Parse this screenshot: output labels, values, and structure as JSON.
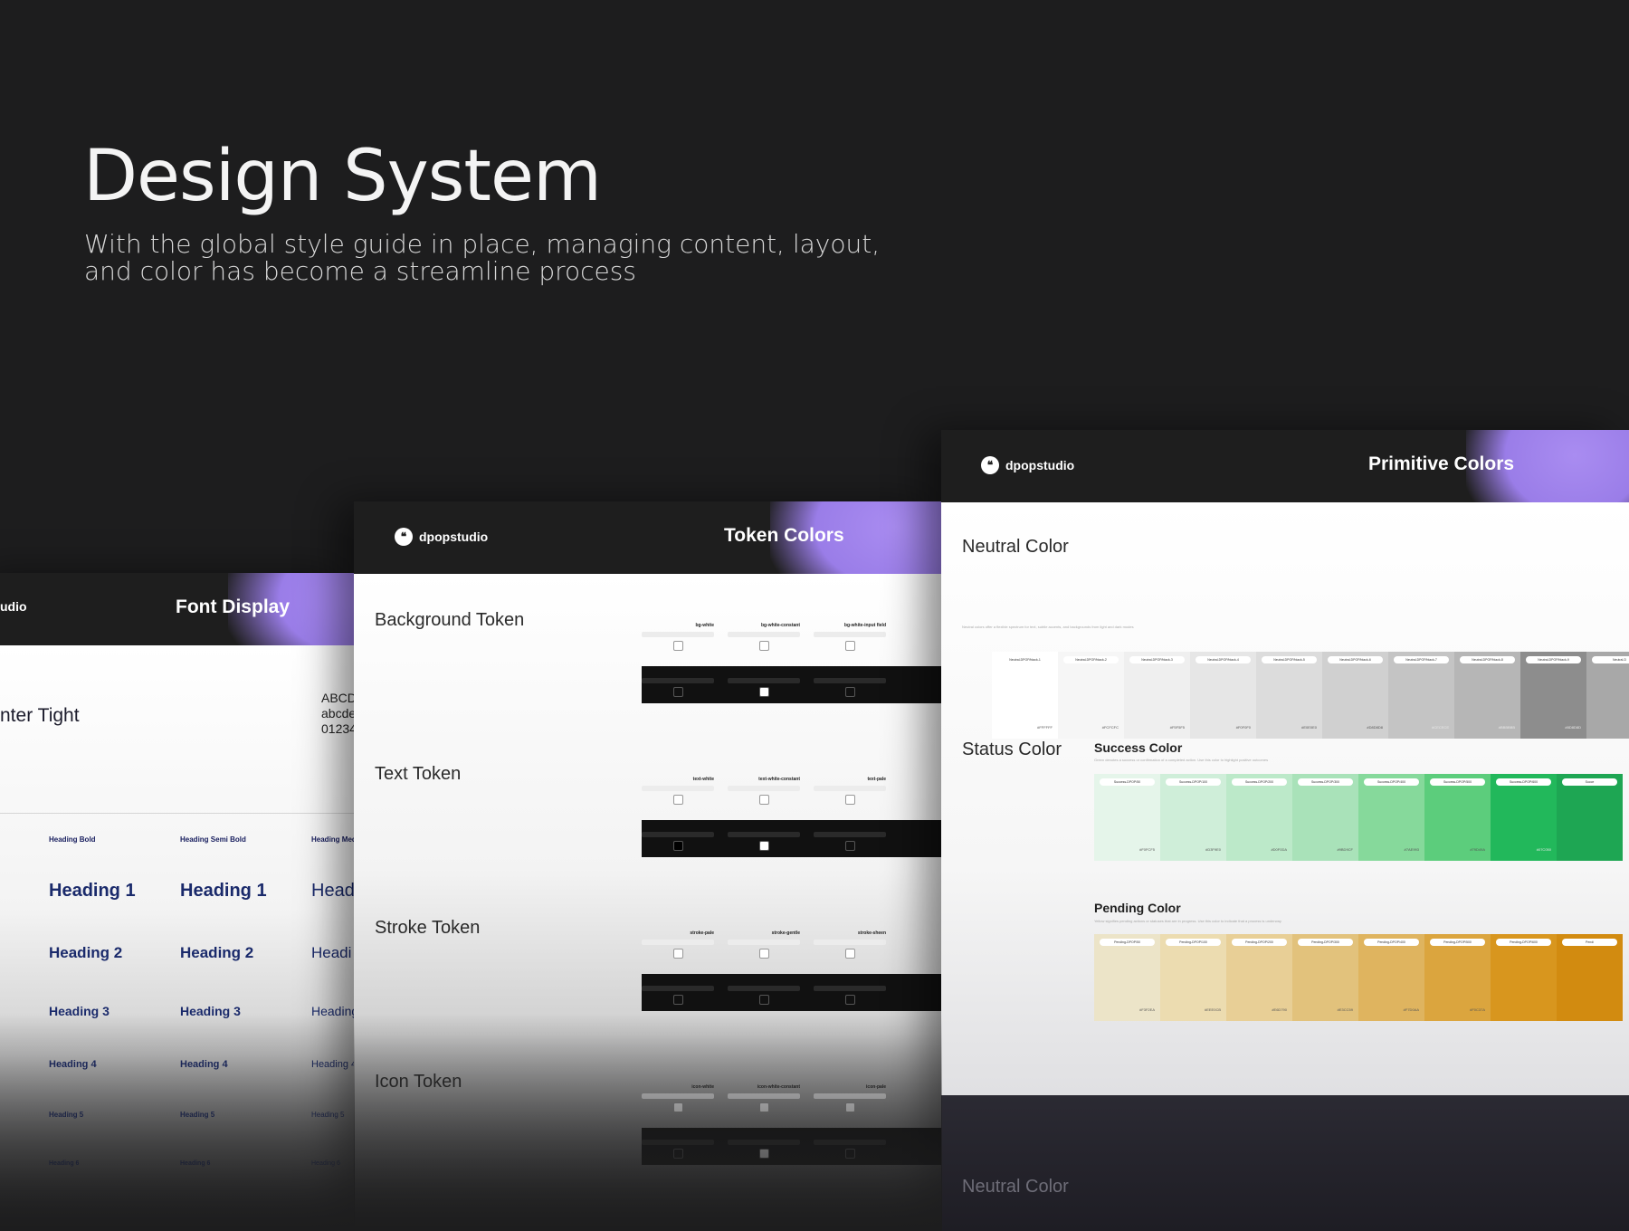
{
  "hero": {
    "title": "Design System",
    "subtitle": "With the global style guide in place, managing content, layout, and color has become a streamline process"
  },
  "brand": {
    "logo_text": "dpopstudio",
    "logo_partial": "udio",
    "accent": "#9a7de8"
  },
  "font_card": {
    "title": "Font Display",
    "font_name": "nter Tight",
    "glyphs": "ABCD\nabcde\n01234",
    "columns": [
      {
        "head": "Heading Bold",
        "items": [
          "Heading 1",
          "Heading 2",
          "Heading 3",
          "Heading 4",
          "Heading 5",
          "Heading 6"
        ]
      },
      {
        "head": "Heading Semi Bold",
        "items": [
          "Heading 1",
          "Heading 2",
          "Heading 3",
          "Heading 4",
          "Heading 5",
          "Heading 6"
        ]
      },
      {
        "head": "Heading Med",
        "items": [
          "Head",
          "Headi",
          "Heading",
          "Heading 4",
          "Heading 5",
          "Heading 6"
        ]
      }
    ]
  },
  "token_card": {
    "title": "Token Colors",
    "sections": [
      {
        "name": "Background Token",
        "tokens": [
          "bg-white",
          "bg-white-constant",
          "bg-white-input field"
        ]
      },
      {
        "name": "Text Token",
        "tokens": [
          "text-white",
          "text-white-constant",
          "text-pale"
        ]
      },
      {
        "name": "Stroke Token",
        "tokens": [
          "stroke-pale",
          "stroke-gentle",
          "stroke-sheen"
        ]
      },
      {
        "name": "Icon Token",
        "tokens": [
          "icon-white",
          "icon-white-constant",
          "icon-pale"
        ]
      }
    ]
  },
  "primitive_card": {
    "title": "Primitive Colors",
    "neutral_title": "Neutral Color",
    "status_title": "Status Color",
    "success_title": "Success Color",
    "pending_title": "Pending Color",
    "neutral_footer_title": "Neutral Color",
    "neutral_swatches": [
      {
        "label": "Neutral-DPOP/black-1",
        "hex": "#FFFFFF",
        "color": "#ffffff"
      },
      {
        "label": "Neutral-DPOP/black-2",
        "hex": "#FCFCFC",
        "color": "#f6f6f6"
      },
      {
        "label": "Neutral-DPOP/black-3",
        "hex": "#F5F5F5",
        "color": "#efefef"
      },
      {
        "label": "Neutral-DPOP/black-4",
        "hex": "#F0F0F0",
        "color": "#e6e6e6"
      },
      {
        "label": "Neutral-DPOP/black-5",
        "hex": "#E0E0E0",
        "color": "#dcdcdc"
      },
      {
        "label": "Neutral-DPOP/black-6",
        "hex": "#D8D8D8",
        "color": "#d0d0d0"
      },
      {
        "label": "Neutral-DPOP/black-7",
        "hex": "#CECECE",
        "color": "#c4c4c4"
      },
      {
        "label": "Neutral-DPOP/black-8",
        "hex": "#BBBBBB",
        "color": "#b6b6b6"
      },
      {
        "label": "Neutral-DPOP/black-9",
        "hex": "#8D8D8D",
        "color": "#8d8d8d"
      },
      {
        "label": "Neutral-D",
        "hex": "",
        "color": "#a8a8a8"
      }
    ],
    "success_swatches": [
      {
        "label": "Success-DPOP/50",
        "hex": "#F0FCF5",
        "color": "#e5f5ea"
      },
      {
        "label": "Success-DPOP/100",
        "hex": "#D3F9E0",
        "color": "#cfeed9"
      },
      {
        "label": "Success-DPOP/200",
        "hex": "#D0F0DA",
        "color": "#bce9c9"
      },
      {
        "label": "Success-DPOP/300",
        "hex": "#9BD9CF",
        "color": "#a9e2b9"
      },
      {
        "label": "Success-DPOP/400",
        "hex": "#7AE993",
        "color": "#86d99b"
      },
      {
        "label": "Success-DPOP/500",
        "hex": "#79D49A",
        "color": "#5ccd7c"
      },
      {
        "label": "Success-DPOP/600",
        "hex": "#07C050",
        "color": "#22b85b"
      },
      {
        "label": "Succe",
        "hex": "",
        "color": "#1ea653"
      }
    ],
    "pending_swatches": [
      {
        "label": "Pending-DPOP/50",
        "hex": "#F3F2EA",
        "color": "#ece4c8"
      },
      {
        "label": "Pending-DPOP/100",
        "hex": "#EEE0CB",
        "color": "#ecdcb0"
      },
      {
        "label": "Pending-DPOP/200",
        "hex": "#E6D790",
        "color": "#e8cf96"
      },
      {
        "label": "Pending-DPOP/300",
        "hex": "#E3CC59",
        "color": "#e2c27c"
      },
      {
        "label": "Pending-DPOP/400",
        "hex": "#F7D0AA",
        "color": "#dfb45f"
      },
      {
        "label": "Pending-DPOP/500",
        "hex": "#F0C37A",
        "color": "#dba53e"
      },
      {
        "label": "Pending-DPOP/600",
        "hex": "",
        "color": "#d8961e"
      },
      {
        "label": "Pendi",
        "hex": "",
        "color": "#d28b10"
      }
    ]
  }
}
